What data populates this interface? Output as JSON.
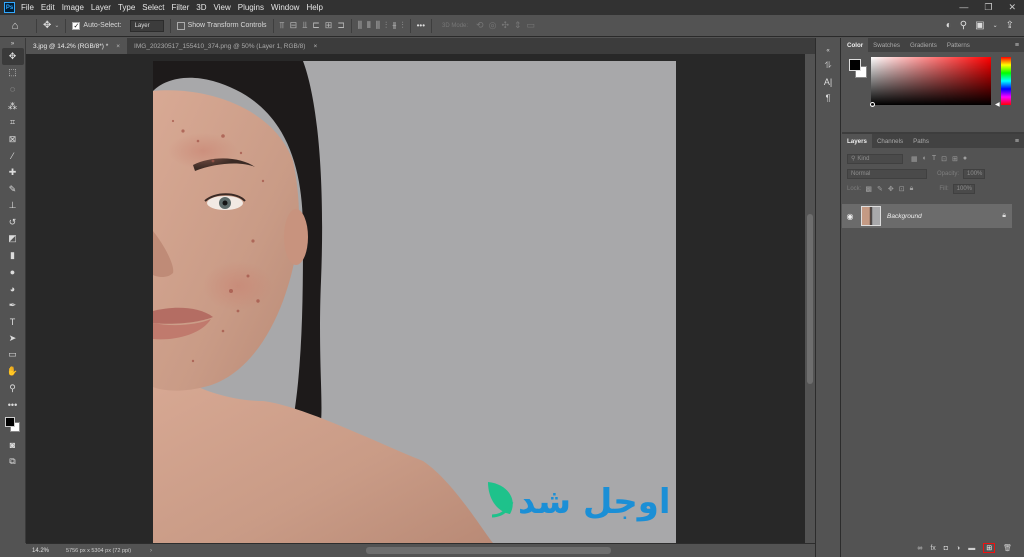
{
  "menubar": {
    "logo": "Ps",
    "items": [
      "File",
      "Edit",
      "Image",
      "Layer",
      "Type",
      "Select",
      "Filter",
      "3D",
      "View",
      "Plugins",
      "Window",
      "Help"
    ],
    "window_controls": [
      "—",
      "❐",
      "✕"
    ]
  },
  "options": {
    "auto_select_label": "Auto-Select:",
    "auto_select_value": "Layer",
    "transform_label": "Show Transform Controls",
    "three_d_label": "3D Mode:",
    "more_label": "•••"
  },
  "tabs": [
    {
      "label": "3.jpg @ 14.2% (RGB/8*) *",
      "close": "×"
    },
    {
      "label": "IMG_20230517_155410_374.png @ 50% (Layer 1, RGB/8)",
      "close": "×"
    }
  ],
  "status": {
    "zoom": "14.2%",
    "doc_size": "5756 px x 5304 px (72 ppi)",
    "arrow": "›"
  },
  "color_panel": {
    "tabs": [
      "Color",
      "Swatches",
      "Gradients",
      "Patterns"
    ],
    "foreground": "#000000",
    "background": "#ffffff"
  },
  "layers_panel": {
    "tabs": [
      "Layers",
      "Channels",
      "Paths"
    ],
    "kind_placeholder": "Kind",
    "blend_mode": "Normal",
    "opacity_label": "Opacity:",
    "opacity_value": "100%",
    "lock_label": "Lock:",
    "fill_label": "Fill:",
    "fill_value": "100%",
    "layer_name": "Background"
  },
  "watermark": {
    "text": "اوجل شد"
  },
  "colors": {
    "accent_highlight": "#e11111",
    "panel_bg": "#535353",
    "canvas_bg": "#282828"
  }
}
